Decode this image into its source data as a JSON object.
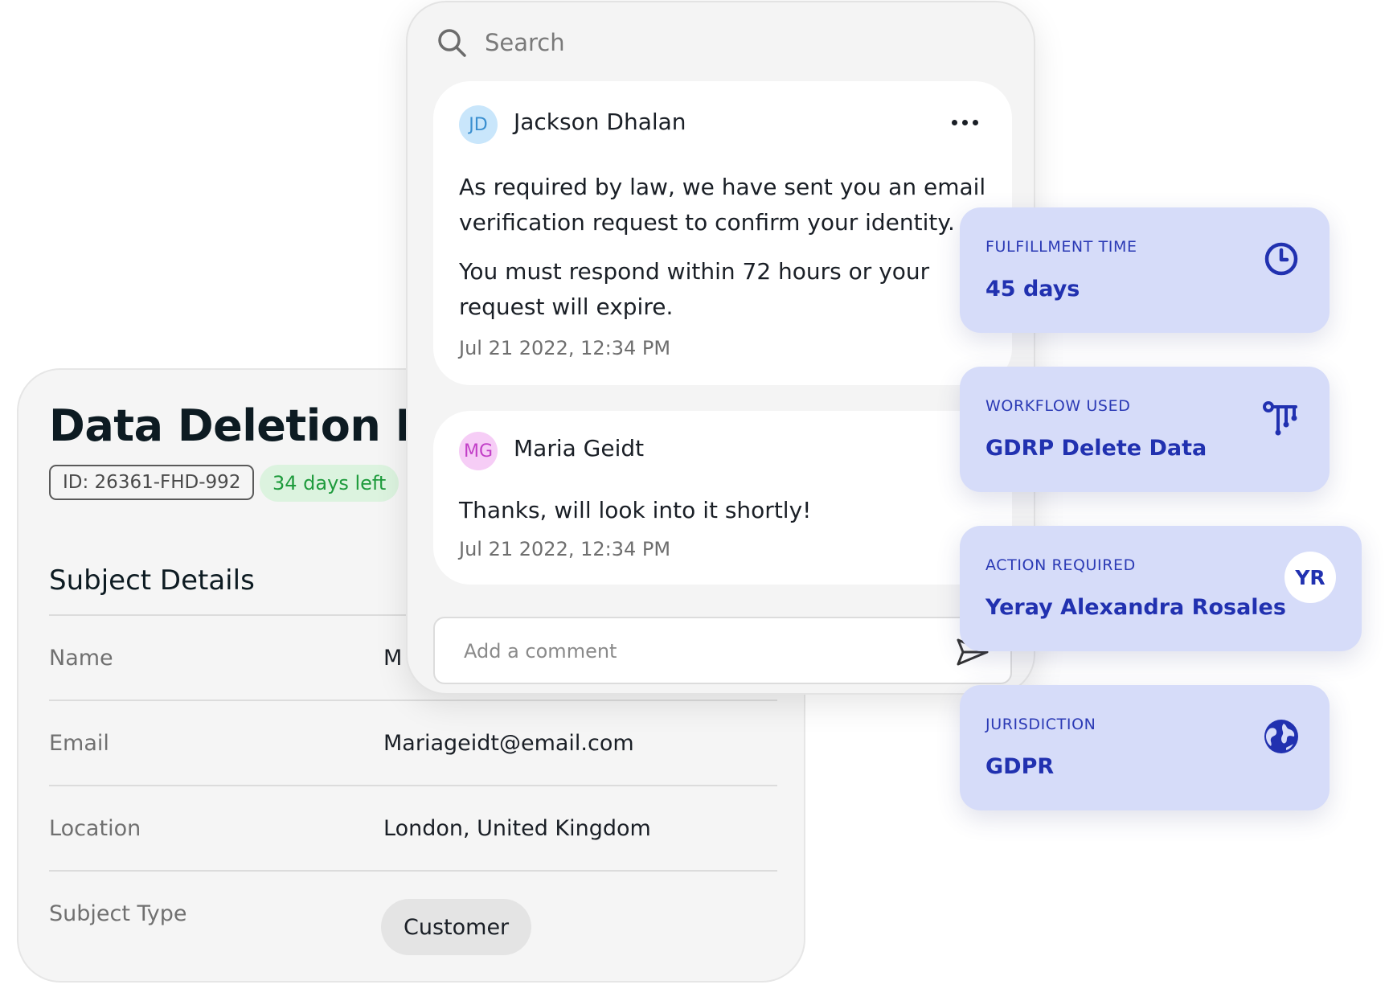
{
  "details": {
    "title": "Data Deletion Re",
    "id_badge": "ID: 26361-FHD-992",
    "days_badge": "34 days left",
    "section_heading": "Subject Details",
    "rows": [
      {
        "label": "Name",
        "value": "M"
      },
      {
        "label": "Email",
        "value": "Mariageidt@email.com"
      },
      {
        "label": "Location",
        "value": "London, United Kingdom"
      },
      {
        "label": "Subject Type",
        "value": "Customer"
      }
    ]
  },
  "comments": {
    "search_placeholder": "Search",
    "items": [
      {
        "initials": "JD",
        "author": "Jackson Dhalan",
        "paragraphs": [
          "As required by law, we have sent you an email verification request to confirm your identity.",
          "You must respond within 72 hours or your request will expire."
        ],
        "timestamp": "Jul 21 2022, 12:34 PM"
      },
      {
        "initials": "MG",
        "author": "Maria Geidt",
        "paragraphs": [
          "Thanks, will look into it shortly!"
        ],
        "timestamp": "Jul 21 2022, 12:34 PM"
      }
    ],
    "comment_placeholder": "Add a comment"
  },
  "info_cards": [
    {
      "label": "FULFILLMENT TIME",
      "value": "45 days",
      "icon": "clock-icon"
    },
    {
      "label": "WORKFLOW USED",
      "value": "GDRP Delete Data",
      "icon": "workflow-icon"
    },
    {
      "label": "ACTION REQUIRED",
      "value": "Yeray Alexandra Rosales",
      "avatar": "YR"
    },
    {
      "label": "JURISDICTION",
      "value": "GDPR",
      "icon": "globe-icon"
    }
  ],
  "colors": {
    "info_card_bg": "#d6dcf9",
    "info_text": "#2131b0",
    "days_badge_bg": "#dcf3df",
    "days_badge_text": "#1e9b3c",
    "avatar_jd": "#c9e6fb",
    "avatar_mg": "#f6cdf6"
  }
}
